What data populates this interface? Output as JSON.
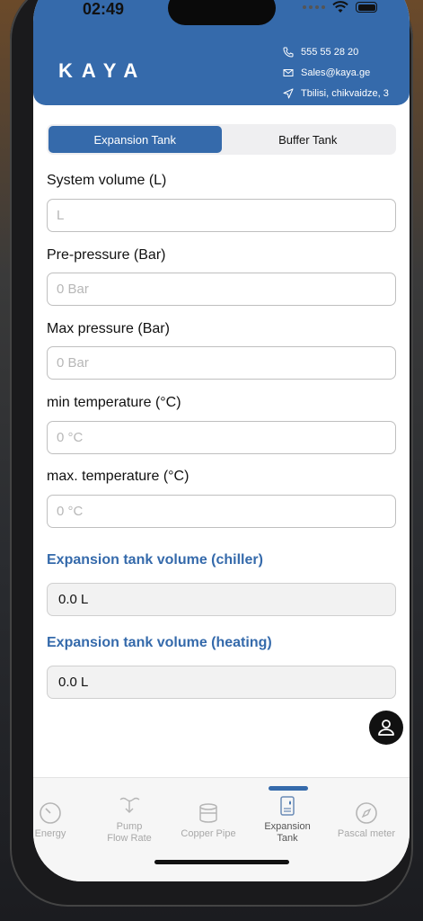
{
  "status": {
    "time": "02:49"
  },
  "header": {
    "logo": "KAYA",
    "phone": "555 55 28 20",
    "email": "Sales@kaya.ge",
    "address": "Tbilisi, chikvaidze, 3"
  },
  "tabs": [
    {
      "label": "Expansion Tank",
      "active": true
    },
    {
      "label": "Buffer Tank",
      "active": false
    }
  ],
  "form": {
    "fields": [
      {
        "label": "System volume  (L)",
        "placeholder": "L",
        "value": ""
      },
      {
        "label": "Pre-pressure (Bar)",
        "placeholder": "0 Bar",
        "value": ""
      },
      {
        "label": "Max pressure (Bar)",
        "placeholder": "0 Bar",
        "value": ""
      },
      {
        "label": "min temperature (°C)",
        "placeholder": "0 °C",
        "value": ""
      },
      {
        "label": "max. temperature (°C)",
        "placeholder": "0 °C",
        "value": ""
      }
    ]
  },
  "results": [
    {
      "label": "Expansion tank volume (chiller)",
      "value": "0.0  L"
    },
    {
      "label": "Expansion tank volume (heating)",
      "value": "0.0  L"
    }
  ],
  "bottom_nav": [
    {
      "label": "Energy",
      "icon": "gauge-icon"
    },
    {
      "label": "Pump\nFlow Rate",
      "icon": "pump-icon"
    },
    {
      "label": "Copper Pipe",
      "icon": "pipe-icon"
    },
    {
      "label": "Expansion\nTank",
      "icon": "tank-icon",
      "active": true
    },
    {
      "label": "Pascal meter",
      "icon": "compass-icon"
    }
  ],
  "colors": {
    "brand": "#356aab"
  }
}
